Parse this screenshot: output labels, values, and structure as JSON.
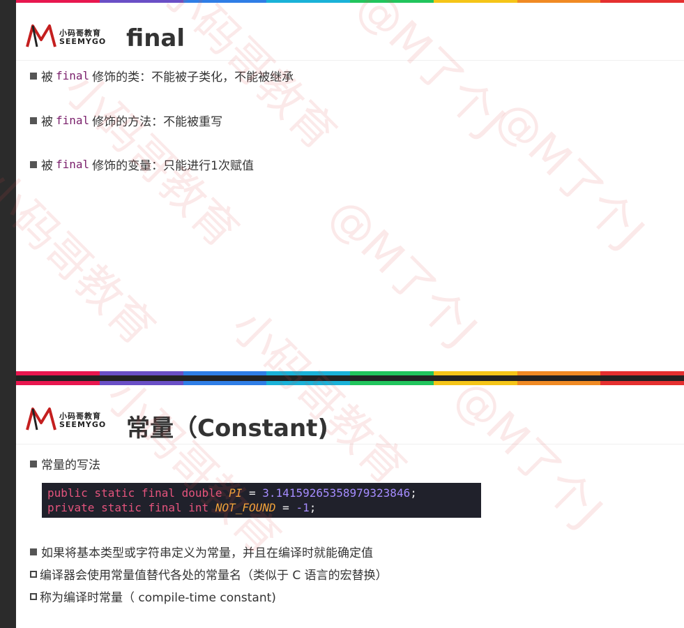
{
  "colors": {
    "rainbow": [
      "#e8174f",
      "#6a4fc6",
      "#2f7ee6",
      "#1ab2d8",
      "#21c55d",
      "#f5c518",
      "#f08a24",
      "#e53030"
    ],
    "keyword": "#7a1f6b",
    "code_bg": "#20212b"
  },
  "logo": {
    "cn": "小码哥教育",
    "en": "SEEMYGO",
    "icon": "m-logo-icon"
  },
  "slide1": {
    "title": "final",
    "bullets": [
      {
        "prefix": "被",
        "keyword": "final",
        "suffix": "修饰的类：不能被子类化，不能被继承"
      },
      {
        "prefix": "被",
        "keyword": "final",
        "suffix": "修饰的方法：不能被重写"
      },
      {
        "prefix": "被",
        "keyword": "final",
        "suffix": "修饰的变量：只能进行1次赋值"
      }
    ]
  },
  "slide2": {
    "title": "常量（Constant)",
    "bullet1": "常量的写法",
    "code": {
      "line1": {
        "mods": "public static final double",
        "name": "PI",
        "op": "=",
        "value": "3.14159265358979323846",
        "end": ";"
      },
      "line2": {
        "mods": "private static final int",
        "name": "NOT_FOUND",
        "op": "=",
        "value": "-1",
        "end": ";"
      }
    },
    "bullet2": "如果将基本类型或字符串定义为常量，并且在编译时就能确定值",
    "sub1": "编译器会使用常量值替代各处的常量名（类似于 C 语言的宏替换）",
    "sub2": "称为编译时常量（ compile-time constant)"
  },
  "watermark": {
    "text1": "小码哥教育",
    "text2": "@M了个J"
  }
}
